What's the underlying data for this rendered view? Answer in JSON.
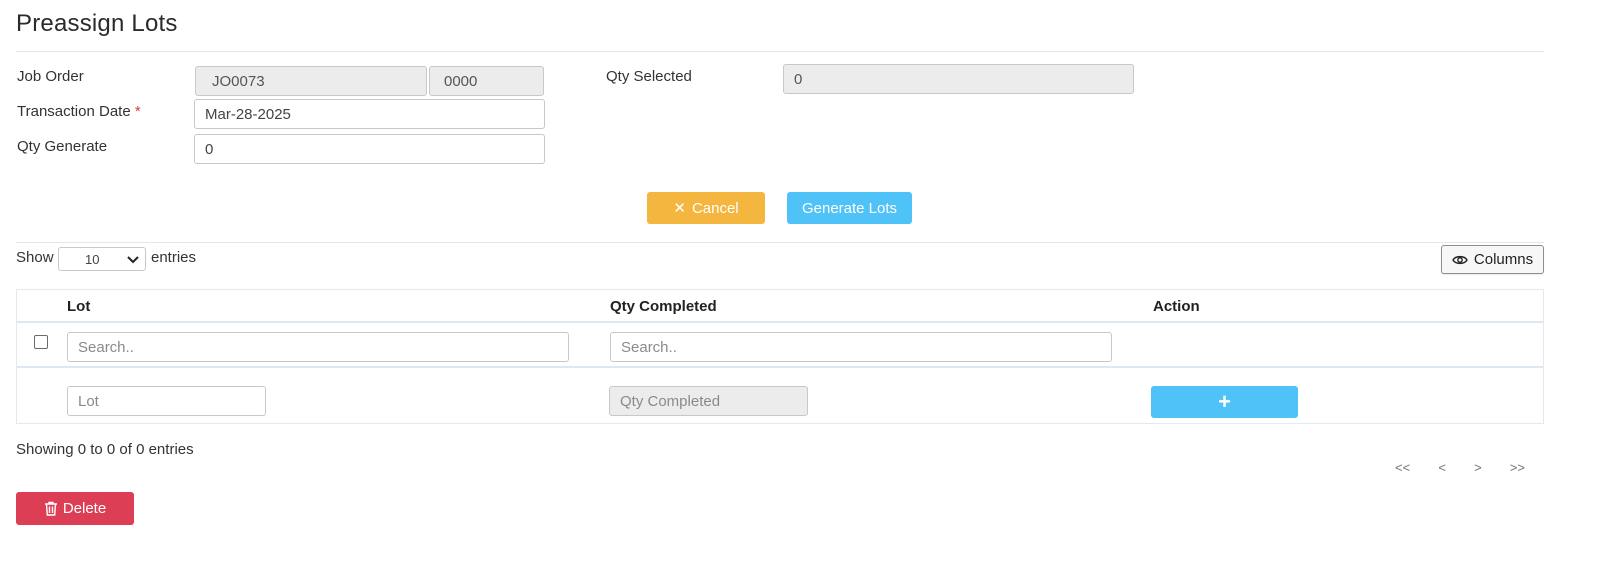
{
  "page": {
    "title": "Preassign Lots"
  },
  "form": {
    "job_order_label": "Job Order",
    "job_order_value": "JO0073",
    "job_order_suffix": "0000",
    "transaction_date_label": "Transaction Date",
    "required_mark": "*",
    "transaction_date_value": "Mar-28-2025",
    "qty_generate_label": "Qty Generate",
    "qty_generate_value": "0",
    "qty_selected_label": "Qty Selected",
    "qty_selected_value": "0"
  },
  "actions": {
    "cancel_icon": "✕",
    "cancel_label": "Cancel",
    "generate_label": "Generate Lots"
  },
  "table_controls": {
    "show_label": "Show",
    "entries_value": "10",
    "entries_label": "entries",
    "columns_label": "Columns"
  },
  "table": {
    "headers": [
      "Lot",
      "Qty Completed",
      "Action"
    ],
    "search_placeholder_lot": "Search..",
    "search_placeholder_qty": "Search..",
    "new_row": {
      "lot_placeholder": "Lot",
      "qty_placeholder": "Qty Completed",
      "add_label": "+"
    }
  },
  "footer": {
    "info": "Showing 0 to 0 of 0 entries",
    "pager": {
      "first": "<<",
      "prev": "<",
      "next": ">",
      "last": ">>"
    },
    "delete_label": "Delete"
  },
  "colors": {
    "cancel": "#f4b63f",
    "generate": "#4fc3f7",
    "delete": "#dc3f55",
    "required": "#dc3545"
  }
}
